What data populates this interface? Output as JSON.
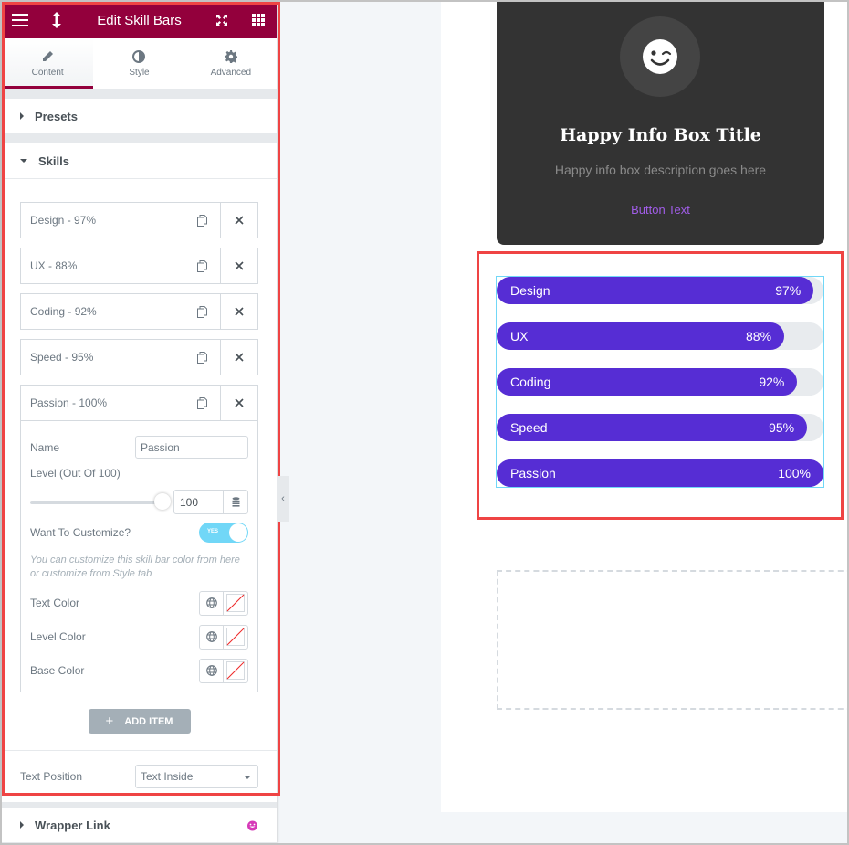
{
  "header": {
    "title": "Edit Skill Bars",
    "menu_icon": "hamburger-icon",
    "resize_icon": "vertical-resize-icon",
    "expand_icon": "expand-icon",
    "grid_icon": "grid-icon"
  },
  "tabs": [
    {
      "label": "Content",
      "icon": "pencil-icon",
      "active": true
    },
    {
      "label": "Style",
      "icon": "half-circle-icon",
      "active": false
    },
    {
      "label": "Advanced",
      "icon": "gear-icon",
      "active": false
    }
  ],
  "sections": {
    "presets": "Presets",
    "skills": "Skills",
    "wrapper_link": "Wrapper Link"
  },
  "skill_items": [
    {
      "title": "Design - 97%"
    },
    {
      "title": "UX - 88%"
    },
    {
      "title": "Coding - 92%"
    },
    {
      "title": "Speed - 95%"
    },
    {
      "title": "Passion - 100%"
    }
  ],
  "expanded_item": {
    "name_label": "Name",
    "name_value": "Passion",
    "level_label": "Level (Out Of 100)",
    "level_value": "100",
    "level_fraction": 1.0,
    "customize_label": "Want To Customize?",
    "customize_toggle": "YES",
    "customize_desc": "You can customize this skill bar color from here or customize from Style tab",
    "text_color_label": "Text Color",
    "level_color_label": "Level Color",
    "base_color_label": "Base Color"
  },
  "add_item_label": "ADD ITEM",
  "text_position": {
    "label": "Text Position",
    "value": "Text Inside"
  },
  "info_box": {
    "title": "Happy Info Box Title",
    "description": "Happy info box description goes here",
    "button": "Button Text",
    "icon": "wink-smiley-icon"
  },
  "skill_bars": [
    {
      "name": "Design",
      "value_label": "97%",
      "level": 97
    },
    {
      "name": "UX",
      "value_label": "88%",
      "level": 88
    },
    {
      "name": "Coding",
      "value_label": "92%",
      "level": 92
    },
    {
      "name": "Speed",
      "value_label": "95%",
      "level": 95
    },
    {
      "name": "Passion",
      "value_label": "100%",
      "level": 100
    }
  ],
  "colors": {
    "brand": "#93003c",
    "bar_fill": "#562dd4",
    "bar_base": "#e8ebee",
    "toggle_on": "#71d7f7",
    "highlight": "#ef4444"
  }
}
